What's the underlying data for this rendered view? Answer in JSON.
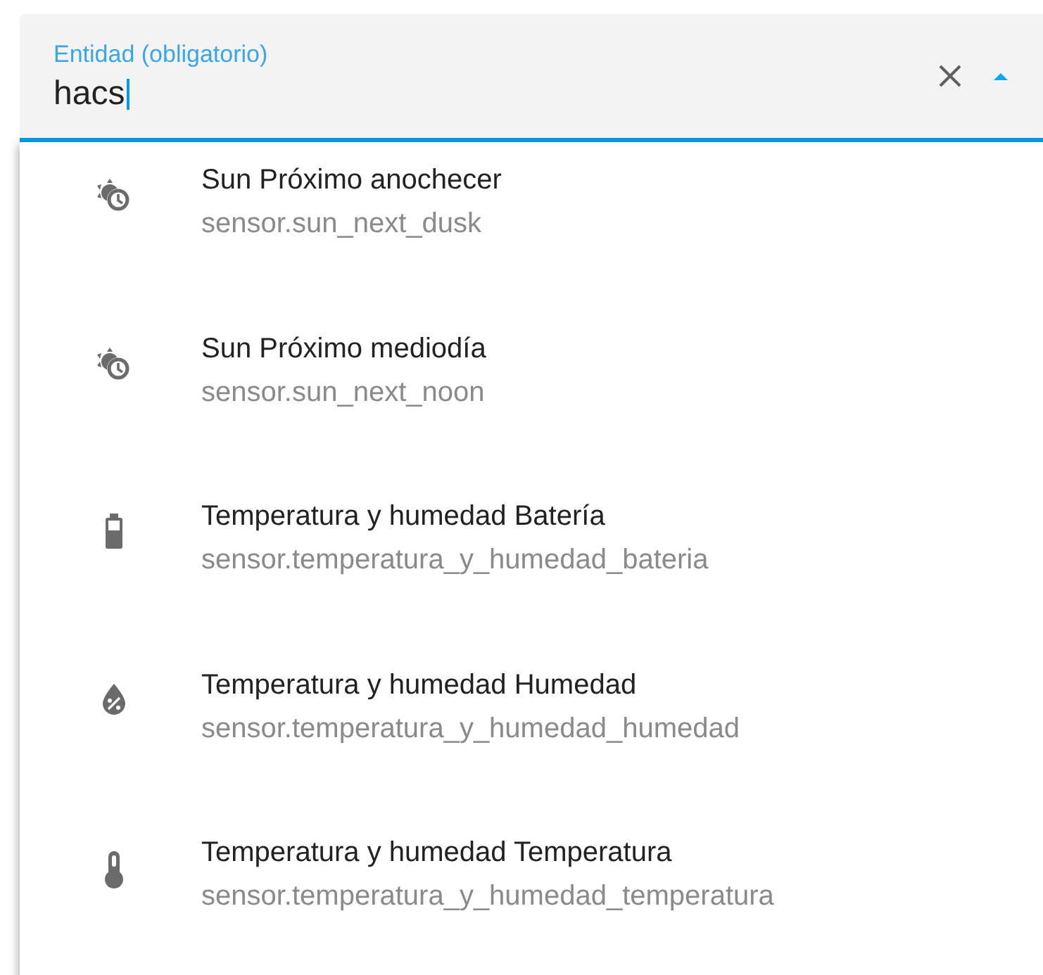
{
  "field": {
    "label": "Entidad (obligatorio)",
    "value": "hacs",
    "expanded": true
  },
  "options": [
    {
      "kind": "sun-clock",
      "name": "Sun Próximo anochecer",
      "entity": "sensor.sun_next_dusk"
    },
    {
      "kind": "sun-clock",
      "name": "Sun Próximo mediodía",
      "entity": "sensor.sun_next_noon"
    },
    {
      "kind": "battery",
      "name": "Temperatura y humedad Batería",
      "entity": "sensor.temperatura_y_humedad_bateria"
    },
    {
      "kind": "humidity",
      "name": "Temperatura y humedad Humedad",
      "entity": "sensor.temperatura_y_humedad_humedad"
    },
    {
      "kind": "thermometer",
      "name": "Temperatura y humedad Temperatura",
      "entity": "sensor.temperatura_y_humedad_temperatura"
    }
  ]
}
